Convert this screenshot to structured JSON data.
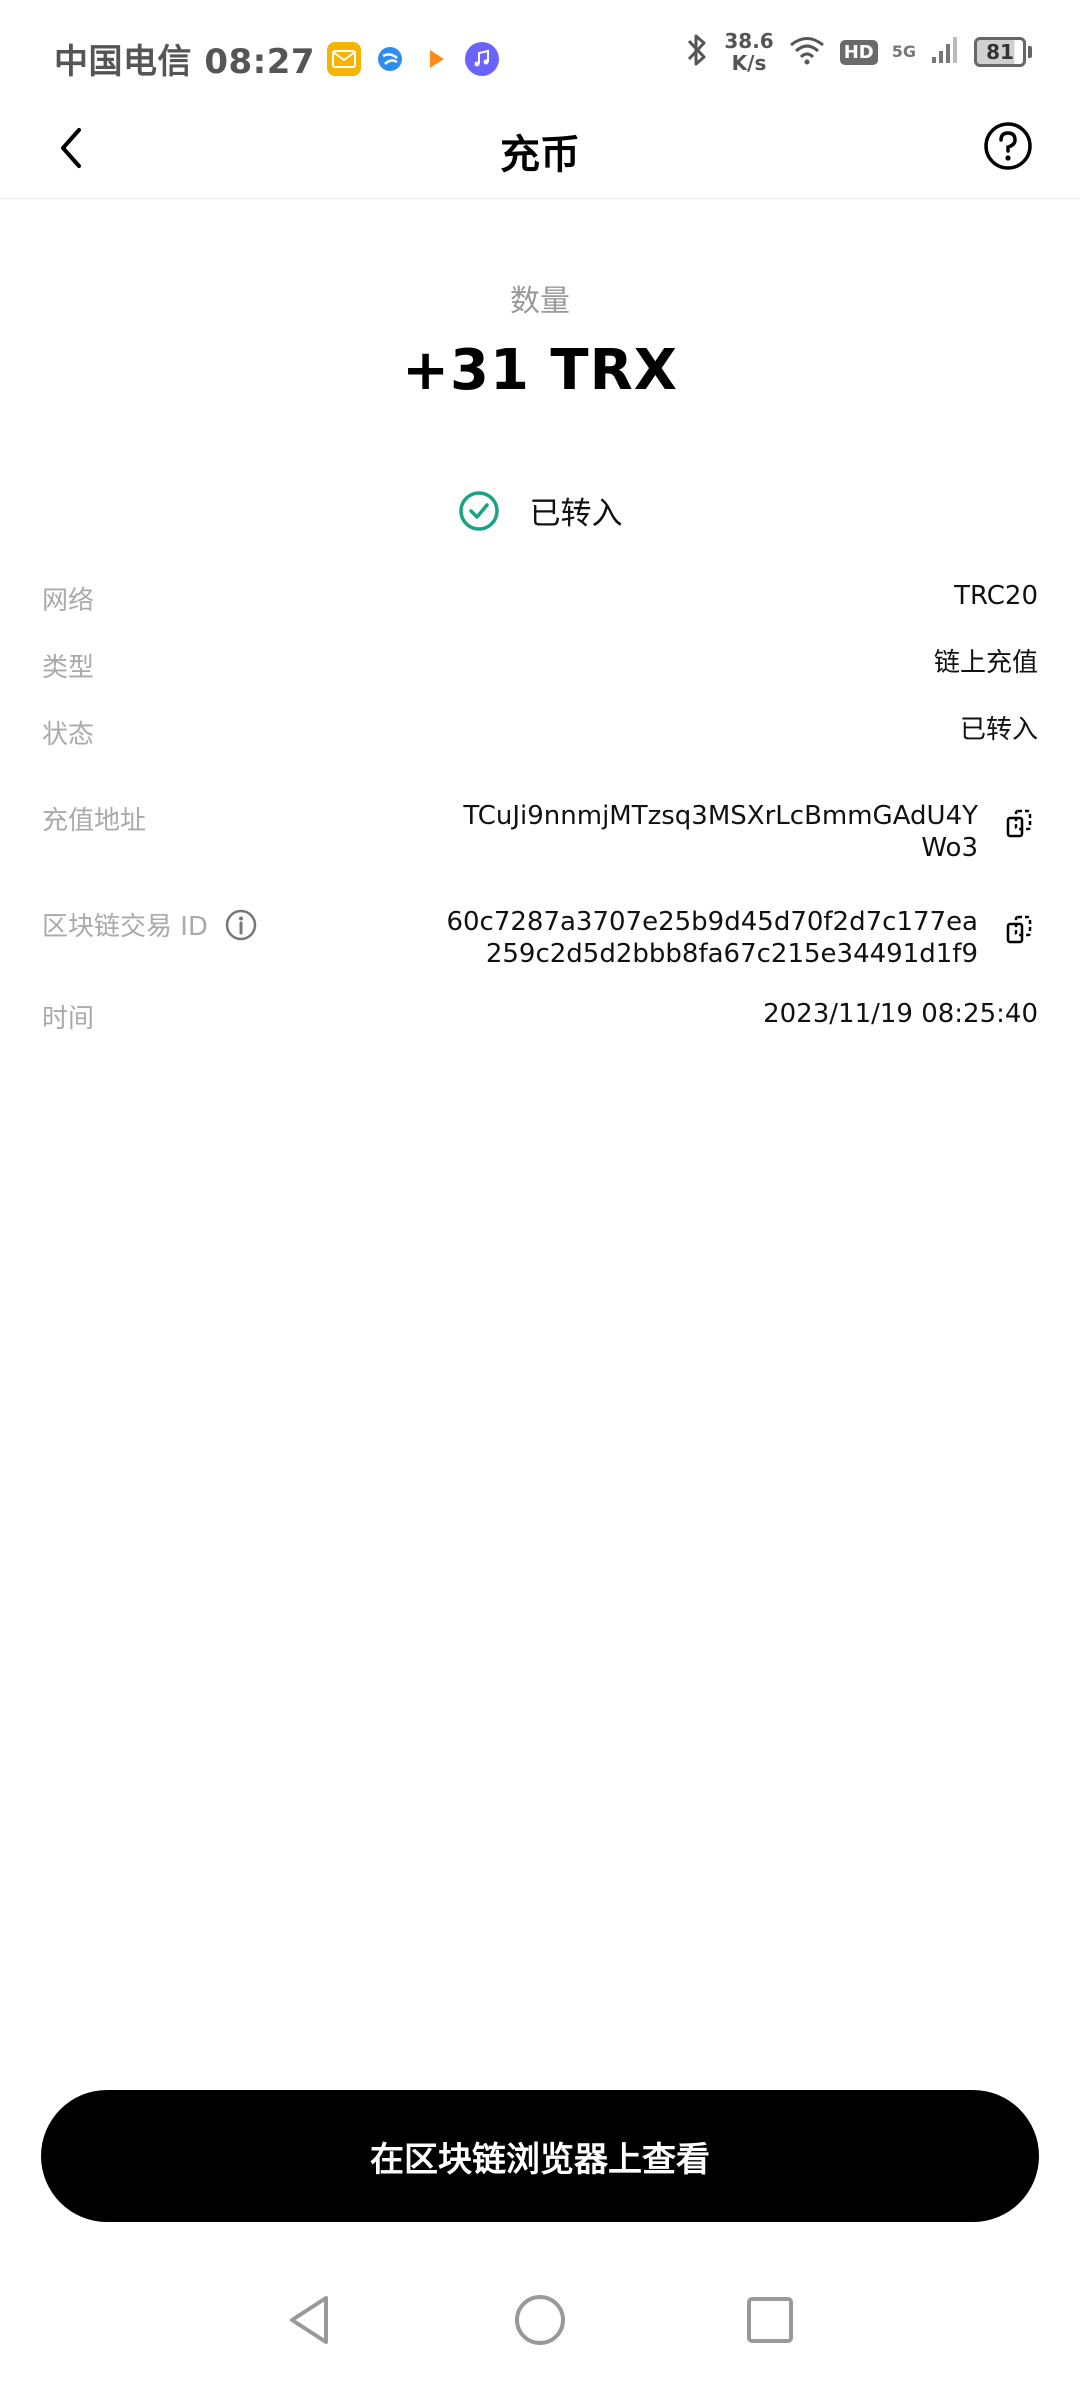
{
  "status_bar": {
    "carrier_time": "中国电信 08:27",
    "speed_value": "38.6",
    "speed_unit": "K/s",
    "hd_label": "HD",
    "net_label": "5G",
    "battery_level": "81",
    "icons": [
      "mail-icon",
      "browser-icon",
      "video-icon",
      "music-icon",
      "bluetooth-icon",
      "wifi-icon",
      "signal-icon",
      "battery-icon"
    ]
  },
  "header": {
    "title": "充币",
    "back_icon": "chevron-left-icon",
    "help_icon": "help-circle-icon"
  },
  "amount": {
    "label": "数量",
    "value": "+31 TRX"
  },
  "status": {
    "text": "已转入",
    "color": "#1aa383"
  },
  "details": {
    "network": {
      "label": "网络",
      "value": "TRC20"
    },
    "type": {
      "label": "类型",
      "value": "链上充值"
    },
    "state": {
      "label": "状态",
      "value": "已转入"
    },
    "address": {
      "label": "充值地址",
      "value": "TCuJi9nnmjMTzsq3MSXrLcBmmGAdU4YWo3"
    },
    "tx_id": {
      "label": "区块链交易 ID",
      "value": "60c7287a3707e25b9d45d70f2d7c177ea259c2d5d2bbb8fa67c215e34491d1f9"
    },
    "time": {
      "label": "时间",
      "value": "2023/11/19 08:25:40"
    }
  },
  "actions": {
    "explorer_button": "在区块链浏览器上查看"
  },
  "colors": {
    "accent_green": "#1aa383",
    "button_bg": "#000000",
    "label_gray": "#aaaaaa"
  }
}
